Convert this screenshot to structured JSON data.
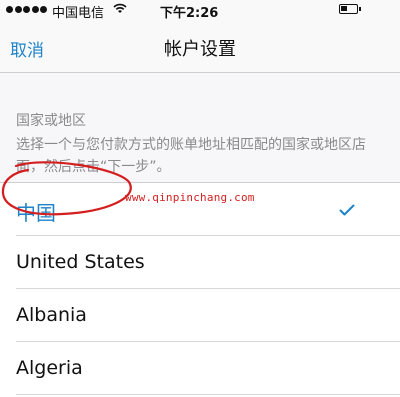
{
  "status_bar": {
    "carrier": "中国电信",
    "time": "下午2:26",
    "signal_icon": "signal-dots-icon",
    "wifi_icon": "wifi-icon",
    "battery_icon": "battery-icon"
  },
  "nav": {
    "cancel_label": "取消",
    "title": "帐户设置"
  },
  "section": {
    "header": "国家或地区",
    "description": "选择一个与您付款方式的账单地址相匹配的国家或地区店面，然后点击“下一步”。"
  },
  "countries": [
    {
      "label": "中国",
      "selected": true
    },
    {
      "label": "United States",
      "selected": false
    },
    {
      "label": "Albania",
      "selected": false
    },
    {
      "label": "Algeria",
      "selected": false
    }
  ],
  "check_icon": "checkmark-icon",
  "watermark": "www.qinpinchang.com",
  "colors": {
    "accent": "#1e83c8",
    "annotation": "#d41f1f",
    "secondary_text": "#8a8a8f",
    "background": "#f7f7f9"
  }
}
